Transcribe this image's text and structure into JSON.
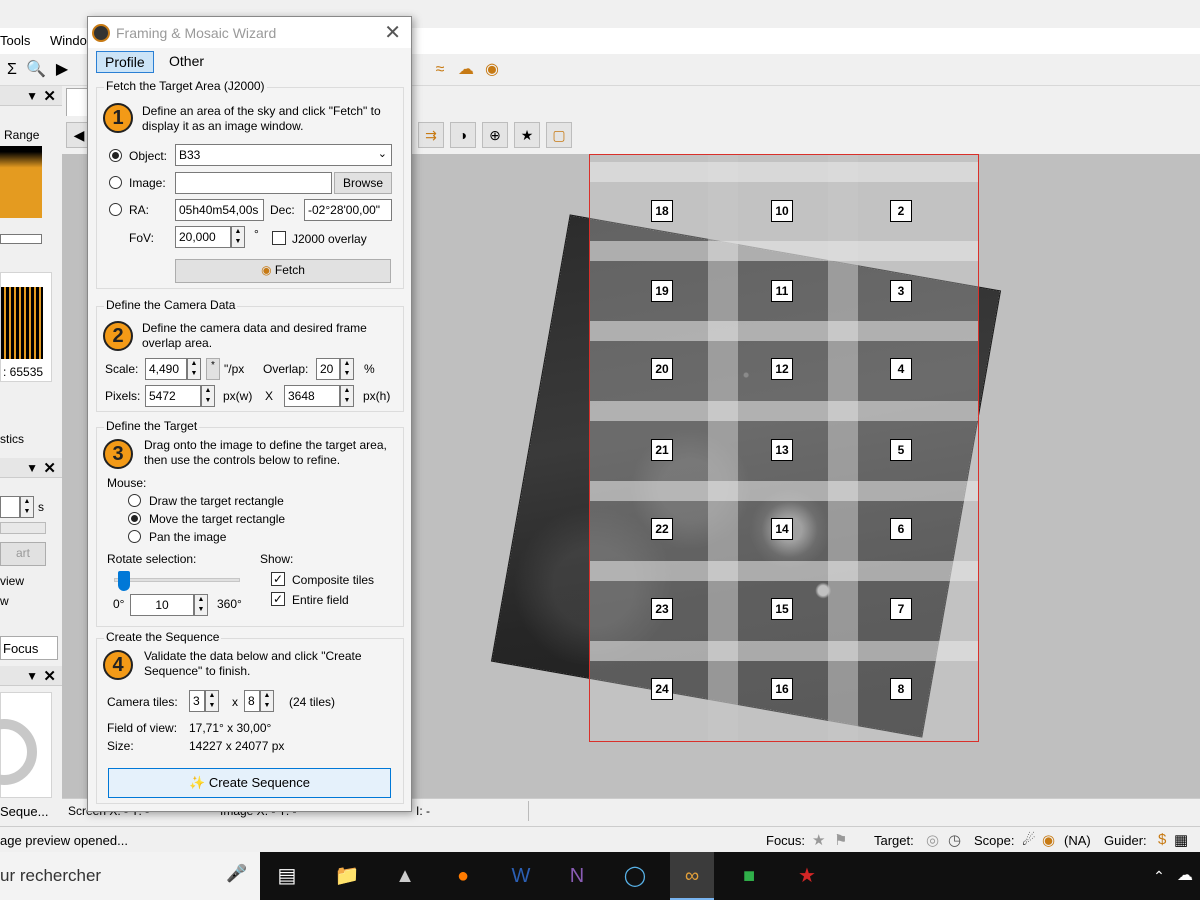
{
  "menu": {
    "tools": "Tools",
    "window": "Windo"
  },
  "left_panel": {
    "range_label": "Range",
    "max_value": ": 65535",
    "tab_statistics": "stics",
    "unit_s": "s",
    "start_label": "art",
    "preview_label": "view",
    "w_label": "w",
    "focus_tab": "Focus",
    "sequence_tab": "Seque..."
  },
  "status": {
    "screen_xy": "Screen X: -  Y: -",
    "image_xy": "Image X: -  Y: -",
    "i_value": "I: -",
    "message": "age preview opened...",
    "focus": "Focus:",
    "target": "Target:",
    "scope": "Scope:",
    "scope_value": "(NA)",
    "guider": "Guider:"
  },
  "taskbar": {
    "search_text": "ur rechercher"
  },
  "wizard": {
    "title": "Framing & Mosaic Wizard",
    "tabs": [
      "Profile",
      "Other"
    ],
    "fetch": {
      "group_title": "Fetch the Target Area (J2000)",
      "step": "1",
      "description": "Define an area of the sky and click \"Fetch\" to display it as an image window.",
      "object_label": "Object:",
      "object_value": "B33",
      "image_label": "Image:",
      "image_value": "",
      "browse_label": "Browse",
      "ra_label": "RA:",
      "ra_value": "05h40m54,00s",
      "dec_label": "Dec:",
      "dec_value": "-02°28'00,00\"",
      "fov_label": "FoV:",
      "fov_value": "20,000",
      "fov_unit": "°",
      "j2000_overlay_label": "J2000 overlay",
      "fetch_button": "Fetch"
    },
    "camera": {
      "group_title": "Define the Camera Data",
      "step": "2",
      "description": "Define the camera data and desired frame overlap area.",
      "scale_label": "Scale:",
      "scale_value": "4,490",
      "scale_star": "*",
      "scale_unit": "\"/px",
      "overlap_label": "Overlap:",
      "overlap_value": "20",
      "overlap_unit": "%",
      "pixels_label": "Pixels:",
      "pixels_w": "5472",
      "pixels_w_unit": "px(w)",
      "times": "X",
      "pixels_h": "3648",
      "pixels_h_unit": "px(h)"
    },
    "target": {
      "group_title": "Define the Target",
      "step": "3",
      "description": "Drag onto the image to define the target area, then use the controls below to refine.",
      "mouse_label": "Mouse:",
      "mouse_options": [
        "Draw the target rectangle",
        "Move the target rectangle",
        "Pan the image"
      ],
      "rotate_label": "Rotate selection:",
      "rotate_min": "0°",
      "rotate_value": "10",
      "rotate_max": "360°",
      "rotate_fraction": 0.03,
      "show_label": "Show:",
      "composite_tiles": "Composite tiles",
      "entire_field": "Entire field"
    },
    "sequence": {
      "group_title": "Create the Sequence",
      "step": "4",
      "description": "Validate the data below and click \"Create Sequence\" to finish.",
      "camera_tiles_label": "Camera tiles:",
      "tiles_x": "3",
      "tiles_times": "x",
      "tiles_y": "8",
      "tiles_total": "(24 tiles)",
      "fov_label": "Field of view:",
      "fov_value": "17,71° x 30,00°",
      "size_label": "Size:",
      "size_value": "14227 x 24077 px",
      "create_button": "Create Sequence"
    }
  },
  "mosaic": {
    "tiles": [
      [
        "18",
        "10",
        "2"
      ],
      [
        "19",
        "11",
        "3"
      ],
      [
        "20",
        "12",
        "4"
      ],
      [
        "21",
        "13",
        "5"
      ],
      [
        "22",
        "14",
        "6"
      ],
      [
        "23",
        "15",
        "7"
      ],
      [
        "24",
        "16",
        "8"
      ]
    ]
  },
  "colors": {
    "accent": "#0078d7",
    "step_badge": "#f39a17",
    "frame": "#d9302a"
  }
}
